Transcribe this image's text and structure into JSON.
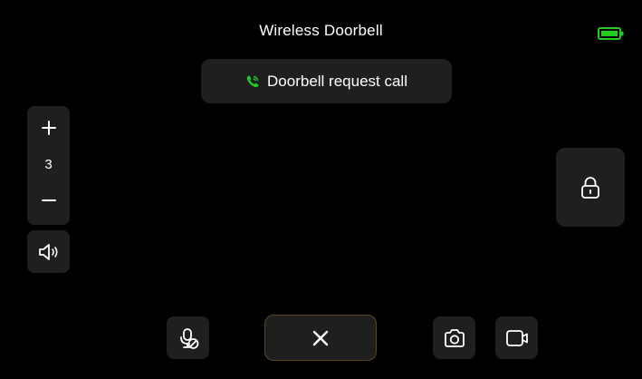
{
  "header": {
    "title": "Wireless Doorbell",
    "battery_icon": "battery-full-icon",
    "battery_color": "#22cc22"
  },
  "toast": {
    "icon": "phone-ringing-icon",
    "icon_color": "#22cc22",
    "text": "Doorbell request call"
  },
  "volume": {
    "increase_icon": "plus-icon",
    "level": "3",
    "decrease_icon": "minus-icon",
    "speaker_icon": "speaker-icon"
  },
  "actions": {
    "unlock_icon": "lock-icon",
    "mute_icon": "mic-off-icon",
    "hangup_icon": "close-icon",
    "snapshot_icon": "camera-icon",
    "record_icon": "video-record-icon",
    "hangup_border_color": "#5a4520"
  }
}
